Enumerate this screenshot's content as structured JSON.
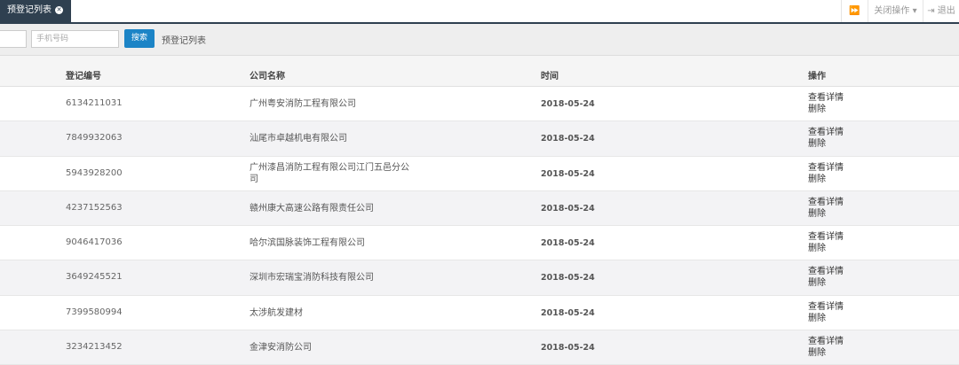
{
  "tabs": {
    "active_label": "预登记列表"
  },
  "header_actions": {
    "close_ops": "关闭操作",
    "logout": "退出"
  },
  "search": {
    "phone_placeholder": "手机号码",
    "button": "搜索",
    "list_label": "预登记列表"
  },
  "table": {
    "headers": {
      "id": "登记编号",
      "company": "公司名称",
      "time": "时间",
      "ops": "操作"
    },
    "view_label": "查看详情",
    "delete_label": "删除",
    "rows": [
      {
        "id": "6134211031",
        "company": "广州粤安消防工程有限公司",
        "date": "2018-05-24"
      },
      {
        "id": "7849932063",
        "company": "汕尾市卓越机电有限公司",
        "date": "2018-05-24"
      },
      {
        "id": "5943928200",
        "company": "广州漆昌消防工程有限公司江门五邑分公司",
        "date": "2018-05-24"
      },
      {
        "id": "4237152563",
        "company": "赣州康大高速公路有限责任公司",
        "date": "2018-05-24"
      },
      {
        "id": "9046417036",
        "company": "哈尔滨国脉装饰工程有限公司",
        "date": "2018-05-24"
      },
      {
        "id": "3649245521",
        "company": "深圳市宏瑞宝消防科技有限公司",
        "date": "2018-05-24"
      },
      {
        "id": "7399580994",
        "company": "太涉航发建材",
        "date": "2018-05-24"
      },
      {
        "id": "3234213452",
        "company": "金津安消防公司",
        "date": "2018-05-24"
      }
    ]
  },
  "colors": {
    "nav_dark": "#2f4050",
    "primary": "#1c84c6"
  },
  "icons": {
    "tab_close": "close-circle-icon",
    "forward": "forward-icon",
    "logout": "logout-icon"
  }
}
